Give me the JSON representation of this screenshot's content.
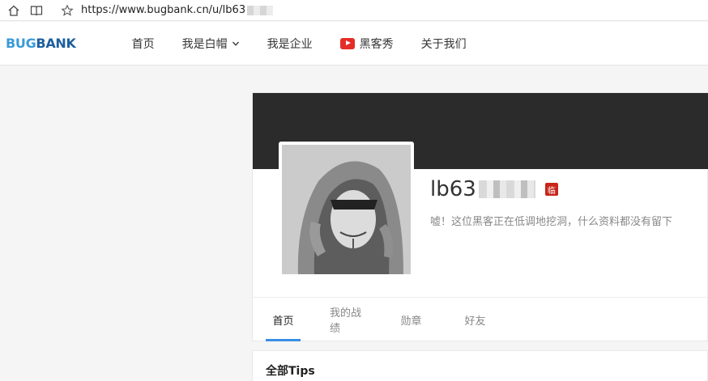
{
  "browser": {
    "url_visible": "https://www.bugbank.cn/u/lb63",
    "home_icon": "home-icon",
    "reader_icon": "book-icon",
    "favorite_icon": "star-icon"
  },
  "site": {
    "logo_part1": "BUG",
    "logo_part2": "BANK",
    "nav": [
      {
        "label": "首页"
      },
      {
        "label": "我是白帽",
        "dropdown": true
      },
      {
        "label": "我是企业"
      },
      {
        "label": "黑客秀",
        "icon": "play-icon"
      },
      {
        "label": "关于我们"
      }
    ]
  },
  "profile": {
    "username": "lb63",
    "badge": "临",
    "bio": "嘘！这位黑客正在低调地挖洞，什么资料都没有留下",
    "tabs": [
      {
        "label": "首页",
        "active": true
      },
      {
        "label": "我的战绩",
        "active": false
      },
      {
        "label": "勋章",
        "active": false
      },
      {
        "label": "好友",
        "active": false
      }
    ]
  },
  "tips": {
    "title": "全部Tips"
  },
  "colors": {
    "accent": "#3a8ee6",
    "cover": "#2b2b2b",
    "badge": "#c7261b",
    "logo_bug": "#3a9ad9",
    "logo_bank": "#1d5f9e"
  }
}
